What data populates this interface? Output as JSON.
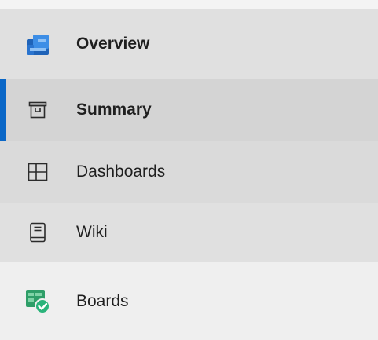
{
  "nav": {
    "items": [
      {
        "key": "overview",
        "label": "Overview",
        "icon": "overview-icon"
      },
      {
        "key": "summary",
        "label": "Summary",
        "icon": "summary-icon"
      },
      {
        "key": "dashboards",
        "label": "Dashboards",
        "icon": "dashboards-icon"
      },
      {
        "key": "wiki",
        "label": "Wiki",
        "icon": "wiki-icon"
      },
      {
        "key": "boards",
        "label": "Boards",
        "icon": "boards-icon"
      }
    ],
    "colors": {
      "accent": "#0a67c7",
      "overview_icon": "#2f7bd6",
      "boards_icon": "#2e9e68"
    }
  }
}
